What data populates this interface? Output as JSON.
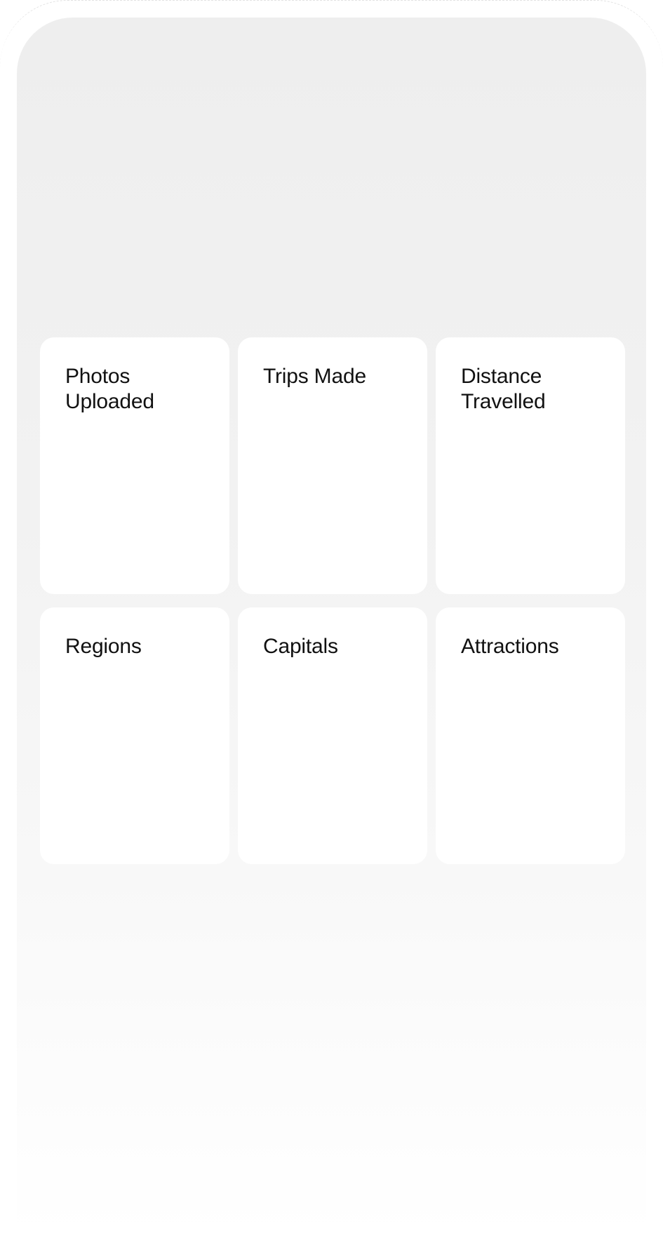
{
  "stats": {
    "cards": [
      {
        "label_line1": "Photos",
        "label_line2": "Uploaded"
      },
      {
        "label_line1": "Trips Made",
        "label_line2": ""
      },
      {
        "label_line1": "Distance",
        "label_line2": "Travelled"
      },
      {
        "label_line1": "Regions",
        "label_line2": ""
      },
      {
        "label_line1": "Capitals",
        "label_line2": ""
      },
      {
        "label_line1": "Attractions",
        "label_line2": ""
      }
    ]
  }
}
